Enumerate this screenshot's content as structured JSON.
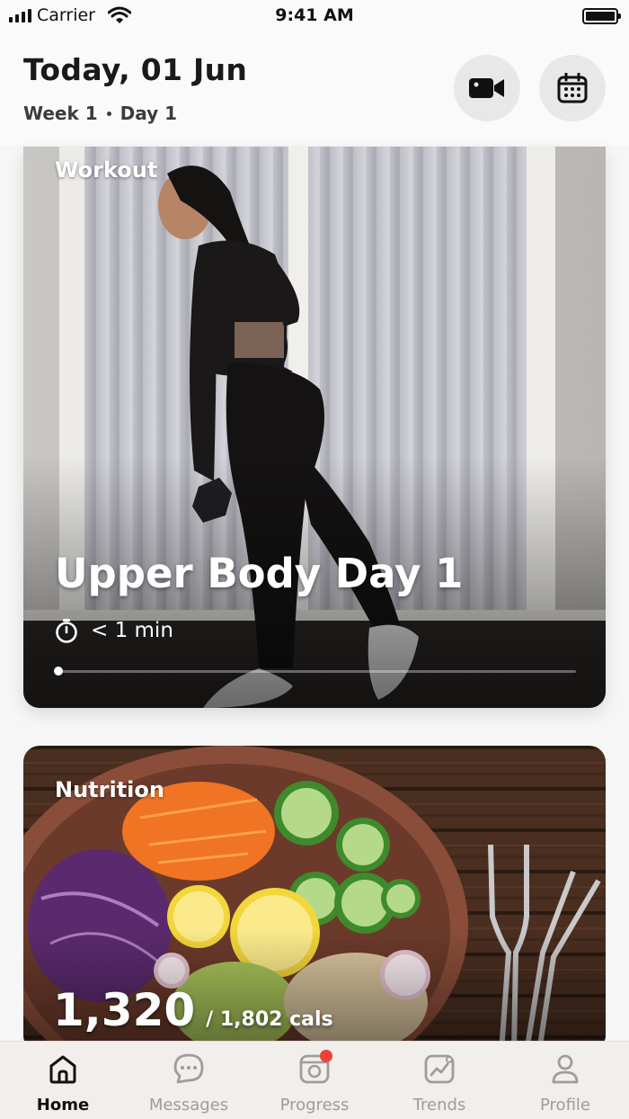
{
  "status_bar": {
    "carrier": "Carrier",
    "time": "9:41 AM"
  },
  "header": {
    "title": "Today, 01 Jun",
    "week": "Week 1",
    "day": "Day 1"
  },
  "workout_card": {
    "label": "Workout",
    "title": "Upper Body Day 1",
    "duration": "< 1 min",
    "progress": 0.0
  },
  "nutrition_card": {
    "label": "Nutrition",
    "calories_consumed": "1,320",
    "calories_goal": "/ 1,802 cals"
  },
  "tabs": [
    {
      "label": "Home",
      "icon": "home-icon",
      "active": true
    },
    {
      "label": "Messages",
      "icon": "chat-bubble-icon",
      "active": false
    },
    {
      "label": "Progress",
      "icon": "camera-icon",
      "active": false,
      "badge": true
    },
    {
      "label": "Trends",
      "icon": "trends-chart-icon",
      "active": false
    },
    {
      "label": "Profile",
      "icon": "person-icon",
      "active": false
    }
  ],
  "colors": {
    "badge": "#ef4238",
    "active_tab": "#111111",
    "inactive_tab": "#9d9d9d"
  }
}
